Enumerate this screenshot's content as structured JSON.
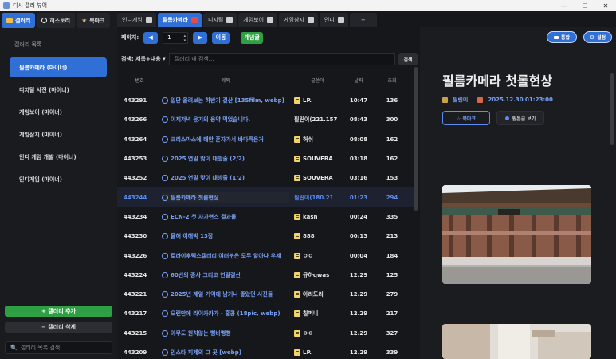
{
  "window": {
    "title": "디시 갤러 뷰어",
    "controls": [
      "—",
      "☐",
      "✕"
    ]
  },
  "topnav": [
    {
      "label": "갤러리",
      "icon": "folder-icon",
      "active": true
    },
    {
      "label": "히스토리",
      "icon": "clock-icon",
      "active": false
    },
    {
      "label": "북마크",
      "icon": "star-icon",
      "active": false
    }
  ],
  "sidebar": {
    "list_title": "갤러리 목록",
    "items": [
      {
        "label": "필름카메라 (마이너)",
        "active": true
      },
      {
        "label": "디지털 사진 (마이너)",
        "active": false
      },
      {
        "label": "게임보이 (마이너)",
        "active": false
      },
      {
        "label": "게임삼지 (마이너)",
        "active": false
      },
      {
        "label": "인디 게임 개발 (마이너)",
        "active": false
      },
      {
        "label": "인디게임 (마이너)",
        "active": false
      }
    ],
    "add_label": "+ 갤러리 추가",
    "remove_label": "− 갤러리 삭제",
    "search_placeholder": "갤러리 목록 검색..."
  },
  "tabs": [
    {
      "label": "인디게임",
      "active": false
    },
    {
      "label": "필름카메라",
      "active": true
    },
    {
      "label": "디지털",
      "active": false
    },
    {
      "label": "게임보이",
      "active": false
    },
    {
      "label": "게임삼지",
      "active": false
    },
    {
      "label": "인디",
      "active": false
    },
    {
      "label": "+",
      "active": false
    }
  ],
  "pager": {
    "label": "페이지:",
    "prev": "◀",
    "page": "1",
    "next": "▶",
    "go": "이동",
    "new_post": "개념글"
  },
  "search": {
    "scope": "검색: 제목+내용 ▾",
    "placeholder": "갤러리 내 검색...",
    "button": "검색"
  },
  "columns": {
    "num": "번호",
    "title": "제목",
    "author": "글쓴이",
    "time": "날짜",
    "views": "조회"
  },
  "posts": [
    {
      "num": "443291",
      "title": "일단 올려보는 하반기 결산 [135film, webp]",
      "author": "LP.",
      "time": "10:47",
      "views": "136",
      "badge": true,
      "active": false
    },
    {
      "num": "443266",
      "title": "이제저녁 윤기의 용약 먹었습니다.",
      "author": "필린이(221.157",
      "time": "08:43",
      "views": "300",
      "badge": false,
      "active": false
    },
    {
      "num": "443264",
      "title": "크리스마스에 태안 혼자가서 바다찍은거",
      "author": "허쉬",
      "time": "08:08",
      "views": "162",
      "badge": true,
      "active": false
    },
    {
      "num": "443253",
      "title": "2025 연말 맞이 대방출 (2/2)",
      "author": "SOUVERA",
      "time": "03:18",
      "views": "162",
      "badge": true,
      "active": false
    },
    {
      "num": "443252",
      "title": "2025 연말 맞이 대방출 (1/2)",
      "author": "SOUVERA",
      "time": "03:16",
      "views": "153",
      "badge": true,
      "active": false
    },
    {
      "num": "443244",
      "title": "필름카메라 첫롤현상",
      "author": "필린이(180.21",
      "time": "01:23",
      "views": "294",
      "badge": false,
      "active": true
    },
    {
      "num": "443234",
      "title": "ECN-2 첫 자가현스 결과물",
      "author": "kasn",
      "time": "00:24",
      "views": "335",
      "badge": true,
      "active": false
    },
    {
      "num": "443230",
      "title": "올해 이해박 13장",
      "author": "888",
      "time": "00:13",
      "views": "213",
      "badge": true,
      "active": false
    },
    {
      "num": "443226",
      "title": "로라이후렉스갤러리 여러분은 모두 알아나 우세",
      "author": "ㅇㅇ",
      "time": "00:04",
      "views": "184",
      "badge": true,
      "active": false
    },
    {
      "num": "443224",
      "title": "60번의 증사 그리고 연말결산",
      "author": "규하qwas",
      "time": "12.29",
      "views": "125",
      "badge": true,
      "active": false
    },
    {
      "num": "443221",
      "title": "2025년 제일 기억에 남거나 좋았던 사진들",
      "author": "아리도리",
      "time": "12.29",
      "views": "279",
      "badge": true,
      "active": false
    },
    {
      "num": "443217",
      "title": "오랜만에 라이카카가 - 홍콩 (18pic, webp)",
      "author": "칠퍼니",
      "time": "12.29",
      "views": "217",
      "badge": true,
      "active": false
    },
    {
      "num": "443215",
      "title": "아무도 원치않는 뻥바뻥뻥",
      "author": "ㅇㅇ",
      "time": "12.29",
      "views": "327",
      "badge": true,
      "active": false
    },
    {
      "num": "443209",
      "title": "인스타 피제의 그 곳 [webp]",
      "author": "LP.",
      "time": "12.29",
      "views": "339",
      "badge": true,
      "active": false
    }
  ],
  "detail": {
    "download": "통합",
    "settings": "설정",
    "title": "필름카메라 첫롤현상",
    "author": "필린이",
    "datetime": "2025.12.30 01:23:00",
    "bookmark": "☆ 북마크",
    "view_original": "원본글 보기"
  },
  "colors": {
    "accent": "#2f6fd6",
    "green": "#2ea043",
    "bg": "#16171b",
    "link": "#7aa2f7"
  }
}
